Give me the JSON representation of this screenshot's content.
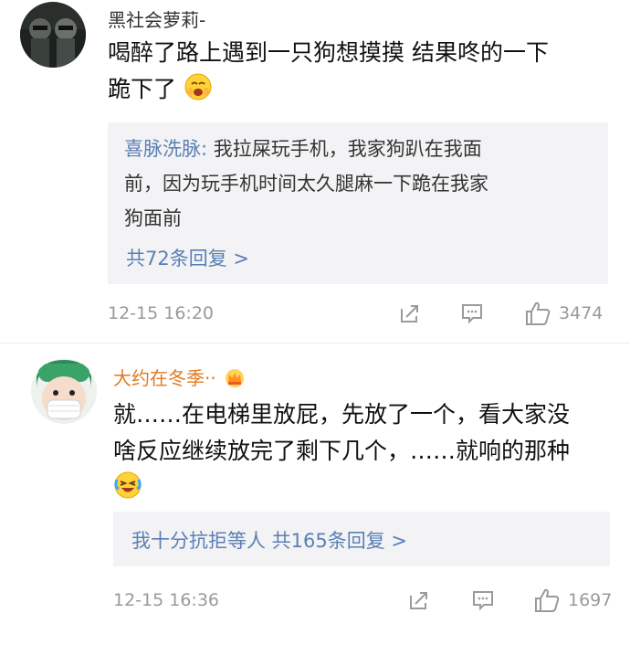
{
  "comments": [
    {
      "username": "黑社会萝莉-",
      "text_line1": "喝醉了路上遇到一只狗想摸摸 结果咚的一下",
      "text_line2": "跪下了",
      "text_emoji": "shy-laugh-emoji",
      "reply": {
        "name": "喜脉洗脉:",
        "line1": " 我拉屎玩手机，我家狗趴在我面",
        "line2": "前，因为玩手机时间太久腿麻一下跪在我家",
        "line3": "狗面前",
        "more_label": "共72条回复 >"
      },
      "timestamp": "12-15 16:20",
      "like_count": "3474"
    },
    {
      "username": "大约在冬季··",
      "username_badge": "crown-badge-icon",
      "text_line1": "就……在电梯里放屁，先放了一个，看大家没",
      "text_line2": "啥反应继续放完了剩下几个，……就响的那种",
      "text_emoji": "crying-laugh-emoji",
      "reply": {
        "name": "我十分抗拒等人",
        "more_label": " 共165条回复 >"
      },
      "timestamp": "12-15 16:36",
      "like_count": "1697"
    }
  ],
  "colors": {
    "link": "#5a7fb5",
    "username2": "#e07a1f",
    "meta": "#9a9a9a",
    "reply_bg": "#f3f3f5"
  }
}
